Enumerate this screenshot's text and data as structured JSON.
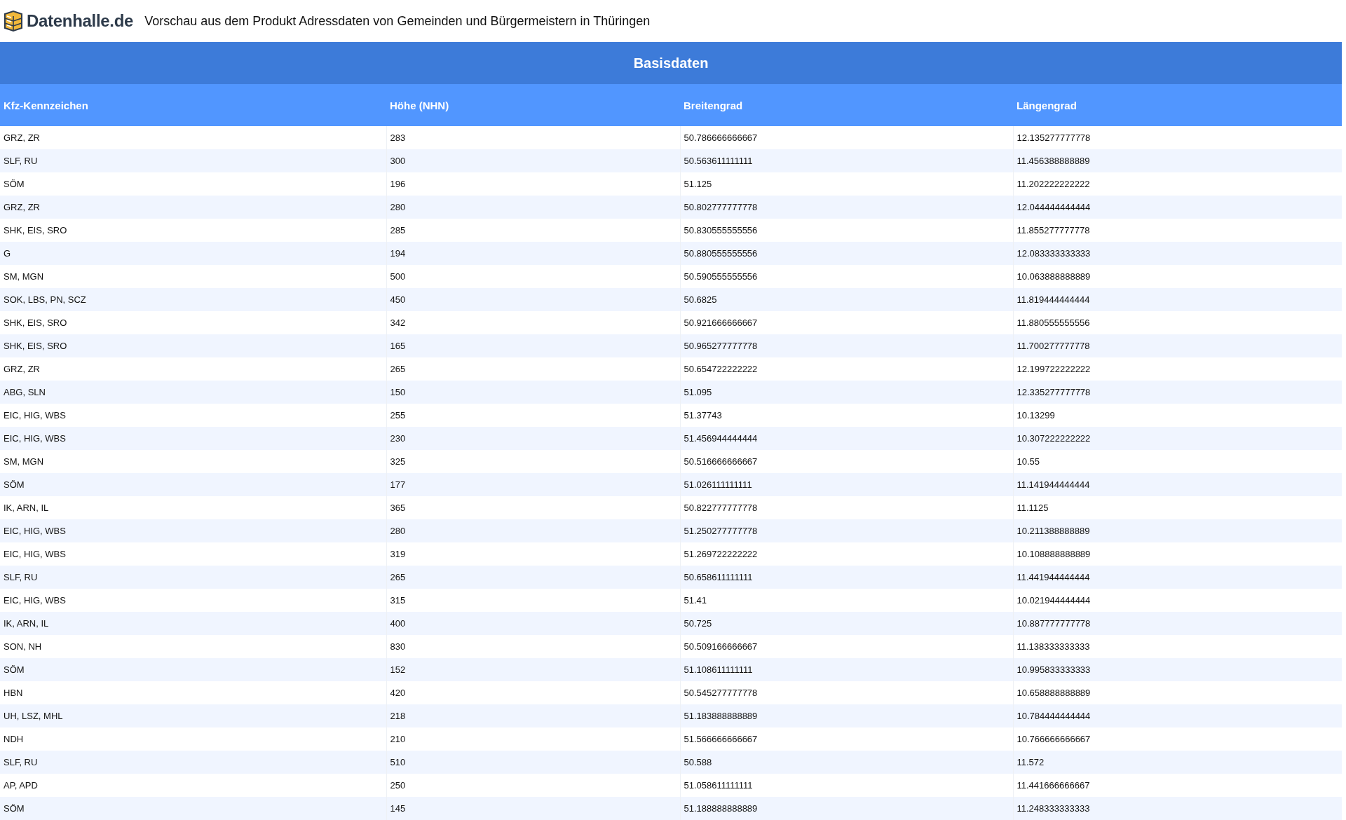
{
  "header": {
    "logo_text": "Datenhalle.de",
    "title": "Vorschau aus dem Produkt Adressdaten von Gemeinden und Bürgermeistern in Thüringen"
  },
  "table": {
    "caption": "Basisdaten",
    "columns": [
      "Kfz-Kennzeichen",
      "Höhe (NHN)",
      "Breitengrad",
      "Längengrad"
    ],
    "rows": [
      [
        "GRZ, ZR",
        "283",
        "50.786666666667",
        "12.135277777778"
      ],
      [
        "SLF, RU",
        "300",
        "50.563611111111",
        "11.456388888889"
      ],
      [
        "SÖM",
        "196",
        "51.125",
        "11.202222222222"
      ],
      [
        "GRZ, ZR",
        "280",
        "50.802777777778",
        "12.044444444444"
      ],
      [
        "SHK, EIS, SRO",
        "285",
        "50.830555555556",
        "11.855277777778"
      ],
      [
        "G",
        "194",
        "50.880555555556",
        "12.083333333333"
      ],
      [
        "SM, MGN",
        "500",
        "50.590555555556",
        "10.063888888889"
      ],
      [
        "SOK, LBS, PN, SCZ",
        "450",
        "50.6825",
        "11.819444444444"
      ],
      [
        "SHK, EIS, SRO",
        "342",
        "50.921666666667",
        "11.880555555556"
      ],
      [
        "SHK, EIS, SRO",
        "165",
        "50.965277777778",
        "11.700277777778"
      ],
      [
        "GRZ, ZR",
        "265",
        "50.654722222222",
        "12.199722222222"
      ],
      [
        "ABG, SLN",
        "150",
        "51.095",
        "12.335277777778"
      ],
      [
        "EIC, HIG, WBS",
        "255",
        "51.37743",
        "10.13299"
      ],
      [
        "EIC, HIG, WBS",
        "230",
        "51.456944444444",
        "10.307222222222"
      ],
      [
        "SM, MGN",
        "325",
        "50.516666666667",
        "10.55"
      ],
      [
        "SÖM",
        "177",
        "51.026111111111",
        "11.141944444444"
      ],
      [
        "IK, ARN, IL",
        "365",
        "50.822777777778",
        "11.1125"
      ],
      [
        "EIC, HIG, WBS",
        "280",
        "51.250277777778",
        "10.211388888889"
      ],
      [
        "EIC, HIG, WBS",
        "319",
        "51.269722222222",
        "10.108888888889"
      ],
      [
        "SLF, RU",
        "265",
        "50.658611111111",
        "11.441944444444"
      ],
      [
        "EIC, HIG, WBS",
        "315",
        "51.41",
        "10.021944444444"
      ],
      [
        "IK, ARN, IL",
        "400",
        "50.725",
        "10.887777777778"
      ],
      [
        "SON, NH",
        "830",
        "50.509166666667",
        "11.138333333333"
      ],
      [
        "SÖM",
        "152",
        "51.108611111111",
        "10.995833333333"
      ],
      [
        "HBN",
        "420",
        "50.545277777778",
        "10.658888888889"
      ],
      [
        "UH, LSZ, MHL",
        "218",
        "51.183888888889",
        "10.784444444444"
      ],
      [
        "NDH",
        "210",
        "51.566666666667",
        "10.766666666667"
      ],
      [
        "SLF, RU",
        "510",
        "50.588",
        "11.572"
      ],
      [
        "AP, APD",
        "250",
        "51.058611111111",
        "11.441666666667"
      ],
      [
        "SÖM",
        "145",
        "51.188888888889",
        "11.248333333333"
      ]
    ]
  }
}
